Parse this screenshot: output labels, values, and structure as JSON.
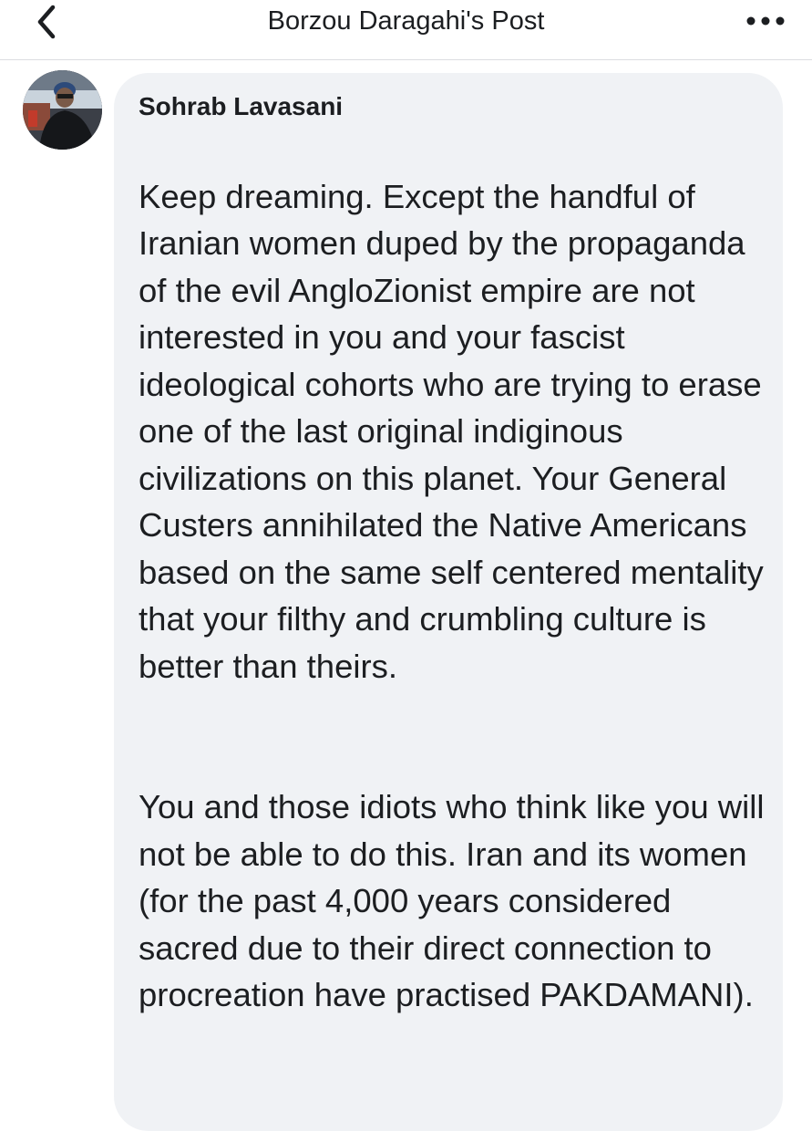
{
  "header": {
    "title": "Borzou Daragahi's Post",
    "back_icon": "chevron-left-icon",
    "more_icon": "more-horizontal-icon"
  },
  "comment": {
    "author": "Sohrab Lavasani",
    "paragraphs": [
      "Keep dreaming. Except the handful of Iranian women duped by the propaganda of the evil AngloZionist empire are not interested in you and your fascist ideological cohorts who are trying to erase one of the last original indiginous civilizations on this planet. Your General Custers annihilated the Native Americans based on the same self centered mentality that your filthy and crumbling culture is better than theirs.",
      "You and those idiots who think like you will not be able to do this. Iran and its women (for the past 4,000 years considered sacred due to their direct connection to procreation have practised PAKDAMANI)."
    ]
  },
  "colors": {
    "bubble_bg": "#f0f2f5",
    "text": "#1c1e21",
    "divider": "#dcdde1"
  }
}
